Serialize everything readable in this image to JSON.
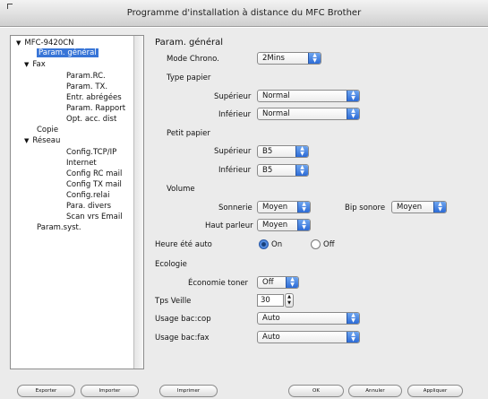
{
  "window": {
    "title": "Programme d'installation à distance du MFC Brother"
  },
  "tree": {
    "items": [
      {
        "label": "MFC-9420CN",
        "arrow": "▼"
      },
      {
        "label": "Param. général"
      },
      {
        "label": "Fax",
        "arrow": "▼"
      },
      {
        "label": "Param.RC."
      },
      {
        "label": "Param. TX."
      },
      {
        "label": "Entr. abrégées"
      },
      {
        "label": "Param. Rapport"
      },
      {
        "label": "Opt. acc. dist"
      },
      {
        "label": "Copie"
      },
      {
        "label": "Réseau",
        "arrow": "▼"
      },
      {
        "label": "Config.TCP/IP"
      },
      {
        "label": "Internet"
      },
      {
        "label": "Config RC mail"
      },
      {
        "label": "Config TX mail"
      },
      {
        "label": "Config.relai"
      },
      {
        "label": "Para. divers"
      },
      {
        "label": "Scan vrs Email"
      },
      {
        "label": "Param.syst."
      }
    ]
  },
  "panel": {
    "section_title": "Param. général",
    "mode_chrono": {
      "label": "Mode Chrono.",
      "value": "2Mins"
    },
    "type_papier": {
      "label": "Type papier",
      "superieur_label": "Supérieur",
      "superieur_value": "Normal",
      "inferieur_label": "Inférieur",
      "inferieur_value": "Normal"
    },
    "petit_papier": {
      "label": "Petit papier",
      "superieur_label": "Supérieur",
      "superieur_value": "B5",
      "inferieur_label": "Inférieur",
      "inferieur_value": "B5"
    },
    "volume": {
      "label": "Volume",
      "sonnerie_label": "Sonnerie",
      "sonnerie_value": "Moyen",
      "bip_label": "Bip sonore",
      "bip_value": "Moyen",
      "haut_parleur_label": "Haut parleur",
      "haut_parleur_value": "Moyen"
    },
    "heure_ete": {
      "label": "Heure été auto",
      "on_label": "On",
      "off_label": "Off"
    },
    "ecologie": {
      "label": "Ecologie",
      "economie_label": "Économie toner",
      "economie_value": "Off"
    },
    "tps_veille": {
      "label": "Tps Veille",
      "value": "30"
    },
    "usage_bac_cop": {
      "label": "Usage bac:cop",
      "value": "Auto"
    },
    "usage_bac_fax": {
      "label": "Usage bac:fax",
      "value": "Auto"
    }
  },
  "buttons": {
    "exporter": "Exporter",
    "importer": "Importer",
    "imprimer": "Imprimer",
    "ok": "OK",
    "annuler": "Annuler",
    "appliquer": "Appliquer"
  }
}
